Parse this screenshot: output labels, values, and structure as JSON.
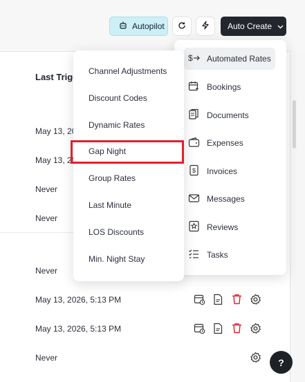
{
  "header": {
    "autopilot_label": "Autopilot",
    "auto_create_label": "Auto Create"
  },
  "table": {
    "column_header": "Last Trigg",
    "rows": [
      "May 13, 20",
      "May 13, 20",
      "Never",
      "Never",
      "Never",
      "May 13, 2026, 5:13 PM",
      "May 13, 2026, 5:13 PM",
      "Never"
    ]
  },
  "left_menu": {
    "items": [
      "Channel Adjustments",
      "Discount Codes",
      "Dynamic Rates",
      "Gap Night",
      "Group Rates",
      "Last Minute",
      "LOS Discounts",
      "Min. Night Stay"
    ]
  },
  "right_menu": {
    "items": [
      {
        "label": "Automated Rates",
        "icon": "dollar-arrow-icon",
        "active": true
      },
      {
        "label": "Bookings",
        "icon": "calendar-icon",
        "active": false
      },
      {
        "label": "Documents",
        "icon": "documents-icon",
        "active": false
      },
      {
        "label": "Expenses",
        "icon": "wallet-icon",
        "active": false
      },
      {
        "label": "Invoices",
        "icon": "invoice-icon",
        "active": false
      },
      {
        "label": "Messages",
        "icon": "mail-icon",
        "active": false
      },
      {
        "label": "Reviews",
        "icon": "star-icon",
        "active": false
      },
      {
        "label": "Tasks",
        "icon": "tasks-icon",
        "active": false
      }
    ]
  },
  "help_label": "?",
  "colors": {
    "autopilot_bg": "#cdeff6",
    "primary_dark": "#23262d",
    "delete_red": "#e21f2c",
    "highlight": "#e21f2c"
  }
}
